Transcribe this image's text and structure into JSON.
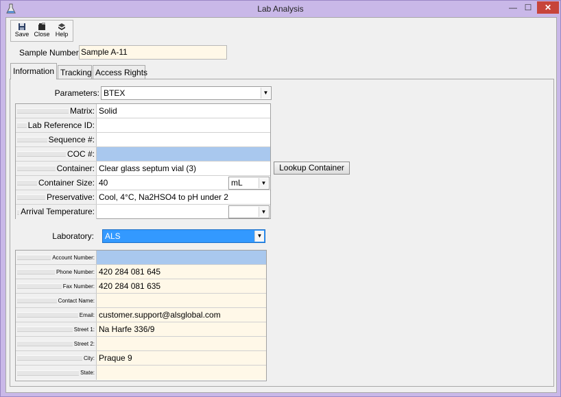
{
  "window": {
    "title": "Lab Analysis",
    "controls": {
      "minimize": "—",
      "maximize": "☐",
      "close": "✕"
    }
  },
  "toolbar": {
    "save_label": "Save",
    "close_label": "Close",
    "help_label": "Help"
  },
  "sample": {
    "label": "Sample Number:",
    "value": "Sample A-11"
  },
  "tabs": [
    {
      "label": "Information",
      "active": true
    },
    {
      "label": "Tracking",
      "active": false
    },
    {
      "label": "Access Rights",
      "active": false
    }
  ],
  "parameters": {
    "label": "Parameters:",
    "value": "BTEX"
  },
  "details_grid": [
    {
      "label": "Matrix:",
      "value": "Solid"
    },
    {
      "label": "Lab Reference ID:",
      "value": ""
    },
    {
      "label": "Sequence #:",
      "value": ""
    },
    {
      "label": "COC #:",
      "value": ""
    },
    {
      "label": "Container:",
      "value": "Clear glass septum vial (3)"
    },
    {
      "label": "Container Size:",
      "value": "40",
      "unit": "mL"
    },
    {
      "label": "Preservative:",
      "value": "Cool, 4°C, Na2HSO4 to pH under 2"
    },
    {
      "label": "Arrival Temperature:",
      "value": "",
      "unit": ""
    }
  ],
  "lookup_container_label": "Lookup Container",
  "laboratory": {
    "label": "Laboratory:",
    "value": "ALS",
    "highlight_color": "#3399ff"
  },
  "lab_grid": [
    {
      "label": "Account Number:",
      "value": ""
    },
    {
      "label": "Phone Number:",
      "value": "420 284 081 645"
    },
    {
      "label": "Fax Number:",
      "value": "420 284 081 635"
    },
    {
      "label": "Contact Name:",
      "value": ""
    },
    {
      "label": "Email:",
      "value": "customer.support@alsglobal.com"
    },
    {
      "label": "Street 1:",
      "value": "Na Harfe 336/9"
    },
    {
      "label": "Street 2:",
      "value": ""
    },
    {
      "label": "City:",
      "value": "Praque 9"
    },
    {
      "label": "State:",
      "value": ""
    }
  ],
  "colors": {
    "title_bar": "#c9b8e8",
    "close_button": "#c7443a",
    "selected_cell": "#a9c8ee",
    "input_background": "#fff8e8"
  }
}
